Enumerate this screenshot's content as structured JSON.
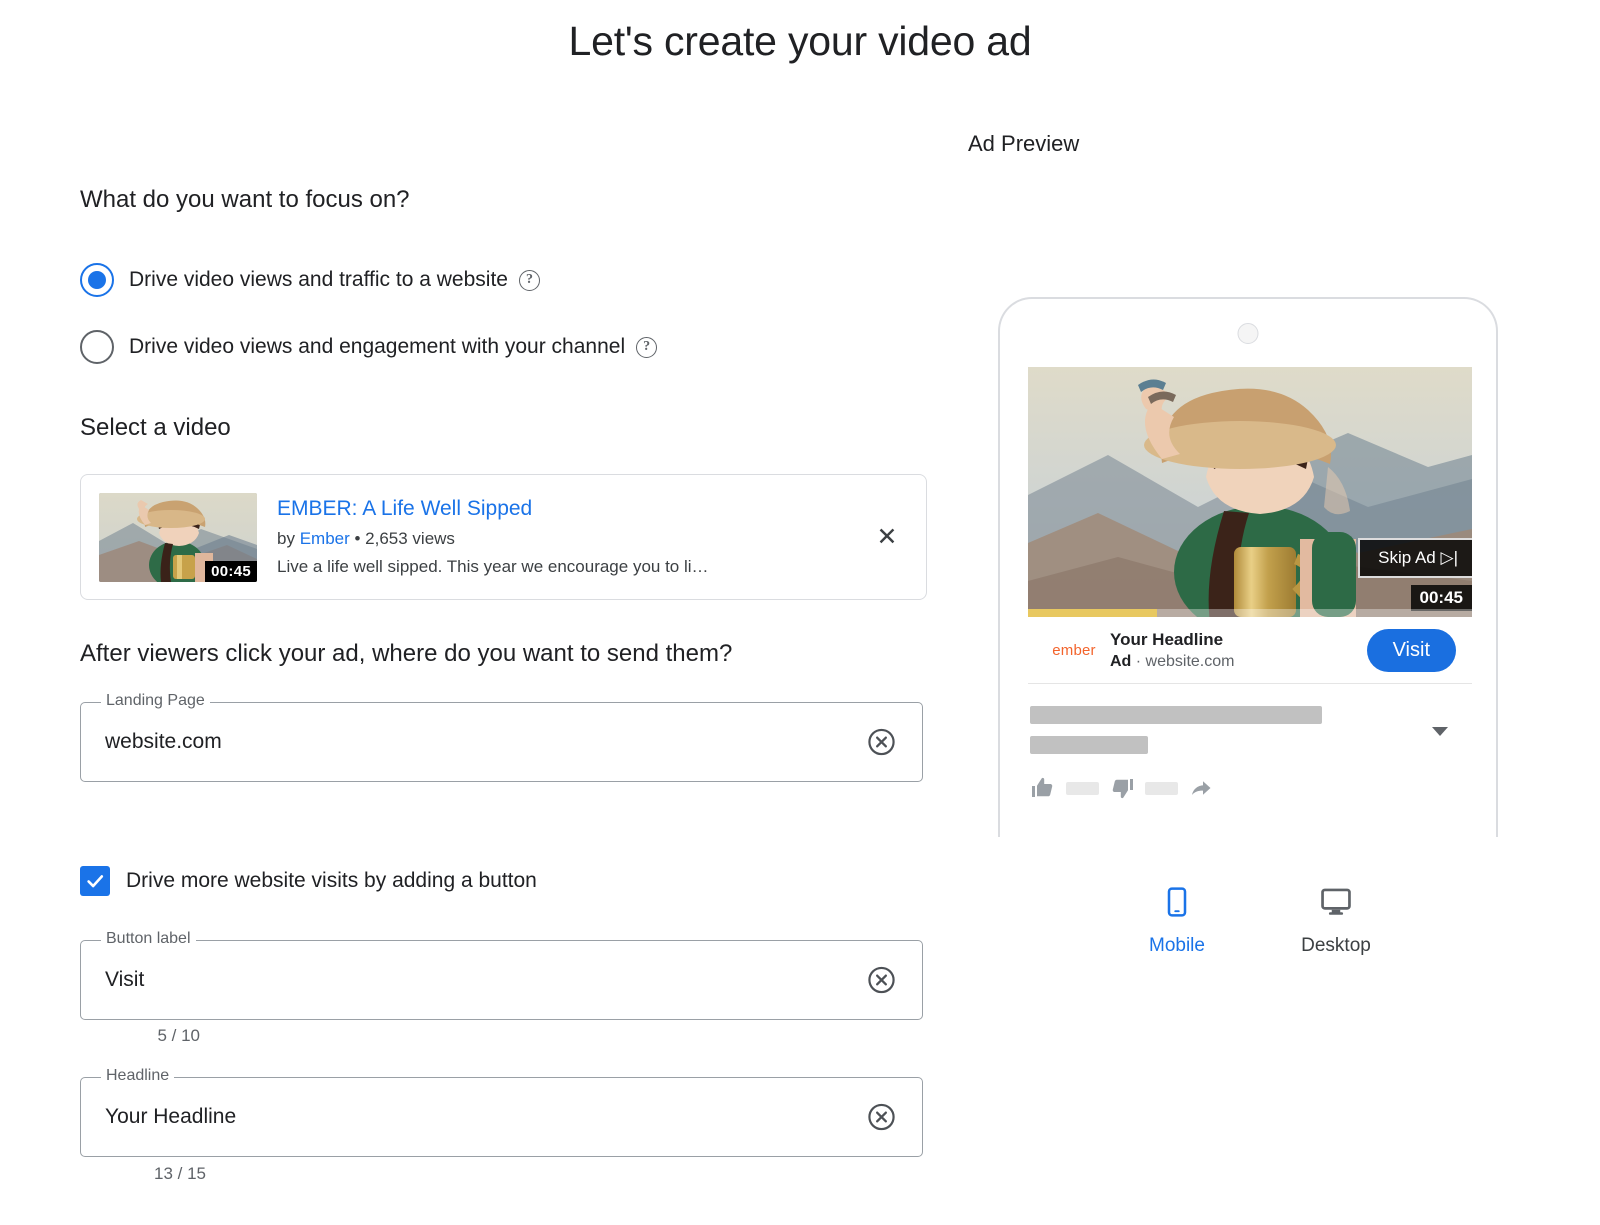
{
  "page": {
    "title": "Let's create your video ad",
    "preview_heading": "Ad Preview"
  },
  "form": {
    "focus": {
      "heading": "What do you want to focus on?",
      "options": [
        {
          "label": "Drive video views and traffic to a website",
          "selected": true,
          "help": "?"
        },
        {
          "label": "Drive video views and engagement with your channel",
          "selected": false,
          "help": "?"
        }
      ]
    },
    "select_video": {
      "heading": "Select a video",
      "video": {
        "title": "EMBER: A Life Well Sipped",
        "by_prefix": "by ",
        "channel": "Ember",
        "views": " • 2,653 views",
        "description": "Live a life well sipped. This year we encourage you to li…",
        "duration": "00:45",
        "remove_label": "✕"
      }
    },
    "destination": {
      "heading": "After viewers click your ad, where do you want to send them?",
      "landing_page": {
        "label": "Landing Page",
        "value": "website.com"
      }
    },
    "cta": {
      "checkbox_label": "Drive more website visits by adding a button",
      "checked": true,
      "button_label_field": {
        "label": "Button label",
        "value": "Visit",
        "counter": "5 / 10"
      },
      "headline_field": {
        "label": "Headline",
        "value": "Your Headline",
        "counter": "13 / 15"
      }
    }
  },
  "preview": {
    "video": {
      "skip_label": "Skip Ad",
      "timer": "00:45",
      "progress_percent": 29
    },
    "ad_bar": {
      "brand": "ember",
      "headline": "Your Headline",
      "ad_tag": "Ad",
      "url": " · website.com",
      "cta_button": "Visit"
    },
    "devices": [
      {
        "label": "Mobile",
        "active": true
      },
      {
        "label": "Desktop",
        "active": false
      }
    ]
  },
  "colors": {
    "accent": "#1a73e8",
    "cta_blue": "#1a6fe0",
    "brand_orange": "#f3642c",
    "progress_yellow": "#e8c860",
    "text": "#202124",
    "muted": "#5f6368",
    "border": "#dadce0"
  }
}
